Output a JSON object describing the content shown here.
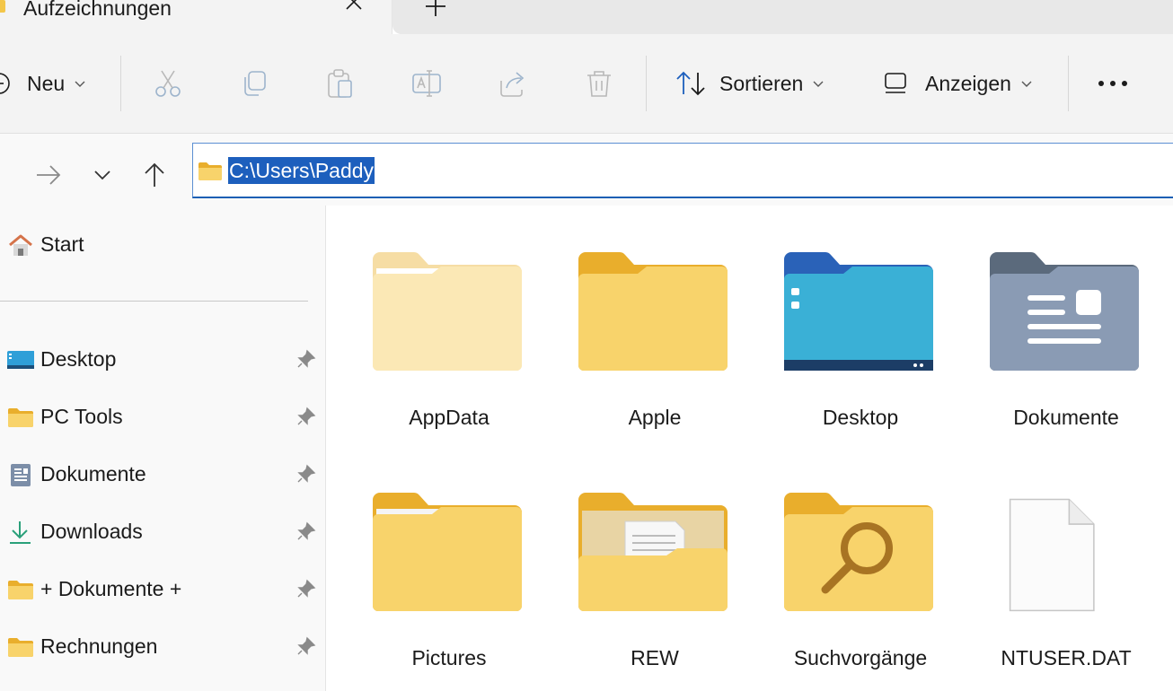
{
  "tab": {
    "title": "Aufzeichnungen",
    "close_icon": "close-icon",
    "new_tab_icon": "plus-icon"
  },
  "commandbar": {
    "new_label": "Neu",
    "sort_label": "Sortieren",
    "view_label": "Anzeigen",
    "icons": [
      "cut-icon",
      "copy-icon",
      "paste-icon",
      "rename-icon",
      "share-icon",
      "delete-icon",
      "more-icon"
    ]
  },
  "address": {
    "path": "C:\\Users\\Paddy"
  },
  "sidebar": {
    "home": {
      "label": "Start",
      "icon": "home-icon"
    },
    "items": [
      {
        "label": "Desktop",
        "icon": "desktop-icon"
      },
      {
        "label": "PC Tools",
        "icon": "folder-icon"
      },
      {
        "label": "Dokumente",
        "icon": "documents-icon"
      },
      {
        "label": "Downloads",
        "icon": "download-icon"
      },
      {
        "label": "+ Dokumente +",
        "icon": "folder-icon"
      },
      {
        "label": "Rechnungen",
        "icon": "folder-icon"
      }
    ]
  },
  "files": [
    {
      "label": "AppData",
      "icon": "hidden-folder-icon"
    },
    {
      "label": "Apple",
      "icon": "folder-icon"
    },
    {
      "label": "Desktop",
      "icon": "desktop-folder-icon"
    },
    {
      "label": "Dokumente",
      "icon": "documents-folder-icon"
    },
    {
      "label": "Pictures",
      "icon": "folder-icon"
    },
    {
      "label": "REW",
      "icon": "folder-with-files-icon"
    },
    {
      "label": "Suchvorgänge",
      "icon": "search-folder-icon"
    },
    {
      "label": "NTUSER.DAT",
      "icon": "file-icon"
    }
  ],
  "colors": {
    "accent": "#1d5fbd",
    "folder": "#f5c84c",
    "commandbar_bg": "#f3f3f3"
  }
}
